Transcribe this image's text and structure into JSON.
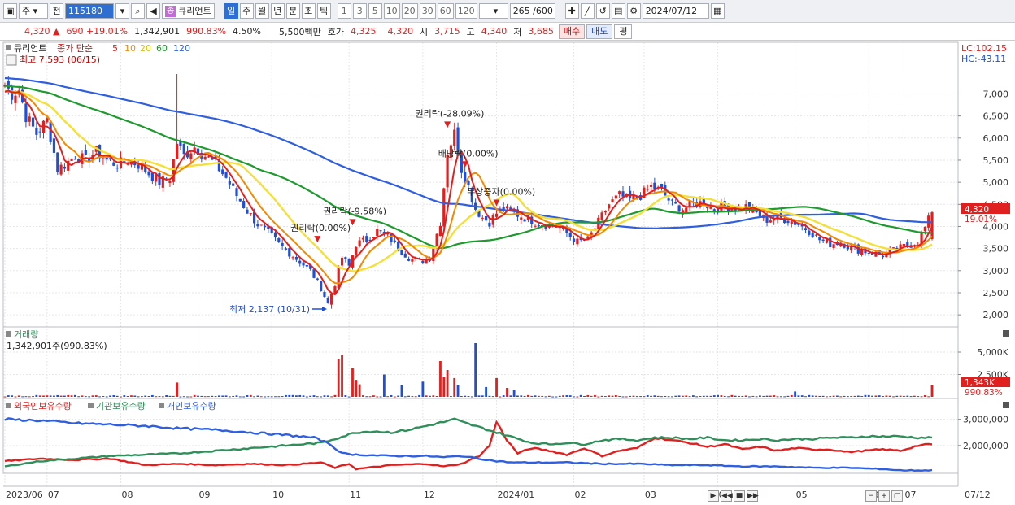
{
  "toolbar": {
    "period_type": "주",
    "prev_label": "전",
    "stock_code": "115180",
    "tag": "종",
    "stock_name": "큐리언트",
    "period_buttons": [
      "일",
      "주",
      "월",
      "년",
      "분",
      "초",
      "틱"
    ],
    "active_period": "일",
    "interval_buttons": [
      "1",
      "3",
      "5",
      "10",
      "20",
      "30",
      "60",
      "120"
    ],
    "count_display": "265 /600",
    "date": "2024/07/12"
  },
  "quote": {
    "price": "4,320 ▲",
    "change": "690 +19.01%",
    "volume": "1,342,901",
    "volume_ratio": "990.83%",
    "turnover_rate": "4.50%",
    "amount": "5,500백만",
    "hoga_label": "호가",
    "ask": "4,325",
    "bid": "4,320",
    "open_label": "시",
    "open": "3,715",
    "high_label": "고",
    "high": "4,340",
    "low_label": "저",
    "low": "3,685",
    "buy_label": "매수",
    "sell_label": "매도",
    "eval_label": "평"
  },
  "colors": {
    "up": "#e0201f",
    "down": "#1f4fd8",
    "ma5": "#e0201f",
    "ma10": "#f28a00",
    "ma20": "#f3e03a",
    "ma60": "#1e9a2e",
    "ma120": "#2f5fe0",
    "foreign": "#e0201f",
    "institution": "#2f8f5a",
    "individual": "#2f5fe0"
  },
  "chart_data": [
    {
      "type": "candlestick",
      "title": "큐리언트",
      "ma_label": "종가 단순",
      "ma_periods": [
        "5",
        "10",
        "20",
        "60",
        "120"
      ],
      "high_note": "최고 7,593 (06/15)",
      "low_note": "최저 2,137 (10/31)",
      "lc_label": "LC:102.15",
      "hc_label": "HC:-43.11",
      "last_price_label": "4,320",
      "last_change_label": "19.01%",
      "ylim": [
        1800,
        7800
      ],
      "yticks": [
        "7,000",
        "6,500",
        "6,000",
        "5,500",
        "5,000",
        "4,500",
        "4,000",
        "3,500",
        "3,000",
        "2,500",
        "2,000"
      ],
      "ytick_values": [
        7000,
        6500,
        6000,
        5500,
        5000,
        4500,
        4000,
        3500,
        3000,
        2500,
        2000
      ],
      "x_labels": [
        "2023/06",
        "07",
        "08",
        "09",
        "10",
        "11",
        "12",
        "2024/01",
        "02",
        "03",
        "04",
        "05",
        "06",
        "07",
        "07/12"
      ],
      "annotations": [
        {
          "text": "권리락(-28.09%)",
          "x": 126,
          "y": 6450
        },
        {
          "text": "배당락(0.00%)",
          "x": 131,
          "y": 5550
        },
        {
          "text": "권리락(-9.58%)",
          "x": 99,
          "y": 4240
        },
        {
          "text": "권리락(0.00%)",
          "x": 89,
          "y": 3860
        },
        {
          "text": "무상증자(0.00%)",
          "x": 140,
          "y": 4680
        }
      ],
      "price_anchors": [
        [
          0,
          7200
        ],
        [
          2,
          7000
        ],
        [
          4,
          7100
        ],
        [
          6,
          6500
        ],
        [
          9,
          6100
        ],
        [
          12,
          6400
        ],
        [
          15,
          5300
        ],
        [
          17,
          5400
        ],
        [
          20,
          5600
        ],
        [
          23,
          5500
        ],
        [
          26,
          5700
        ],
        [
          29,
          5500
        ],
        [
          32,
          5400
        ],
        [
          35,
          5500
        ],
        [
          38,
          5400
        ],
        [
          41,
          5200
        ],
        [
          44,
          5000
        ],
        [
          47,
          5100
        ],
        [
          49,
          5900
        ],
        [
          51,
          5600
        ],
        [
          54,
          5800
        ],
        [
          57,
          5600
        ],
        [
          60,
          5400
        ],
        [
          63,
          5100
        ],
        [
          66,
          4700
        ],
        [
          69,
          4350
        ],
        [
          72,
          4050
        ],
        [
          75,
          3850
        ],
        [
          78,
          3600
        ],
        [
          81,
          3400
        ],
        [
          84,
          3200
        ],
        [
          87,
          3000
        ],
        [
          90,
          2600
        ],
        [
          92,
          2250
        ],
        [
          94,
          2700
        ],
        [
          96,
          3300
        ],
        [
          98,
          3100
        ],
        [
          100,
          3600
        ],
        [
          103,
          3700
        ],
        [
          106,
          3900
        ],
        [
          109,
          3800
        ],
        [
          112,
          3500
        ],
        [
          115,
          3300
        ],
        [
          118,
          3200
        ],
        [
          121,
          3300
        ],
        [
          124,
          4100
        ],
        [
          126,
          5700
        ],
        [
          128,
          6100
        ],
        [
          130,
          5300
        ],
        [
          132,
          4900
        ],
        [
          134,
          4400
        ],
        [
          136,
          4200
        ],
        [
          138,
          4100
        ],
        [
          140,
          4300
        ],
        [
          142,
          4400
        ],
        [
          145,
          4300
        ],
        [
          148,
          4200
        ],
        [
          151,
          4100
        ],
        [
          154,
          4050
        ],
        [
          157,
          4000
        ],
        [
          160,
          3850
        ],
        [
          163,
          3650
        ],
        [
          166,
          3700
        ],
        [
          169,
          4100
        ],
        [
          172,
          4500
        ],
        [
          175,
          4700
        ],
        [
          178,
          4600
        ],
        [
          181,
          4700
        ],
        [
          184,
          4900
        ],
        [
          187,
          4800
        ],
        [
          190,
          4500
        ],
        [
          193,
          4400
        ],
        [
          196,
          4500
        ],
        [
          199,
          4550
        ],
        [
          202,
          4400
        ],
        [
          205,
          4450
        ],
        [
          208,
          4400
        ],
        [
          211,
          4450
        ],
        [
          214,
          4300
        ],
        [
          217,
          4150
        ],
        [
          220,
          4200
        ],
        [
          223,
          4150
        ],
        [
          226,
          4050
        ],
        [
          229,
          3900
        ],
        [
          232,
          3700
        ],
        [
          235,
          3600
        ],
        [
          238,
          3650
        ],
        [
          241,
          3500
        ],
        [
          244,
          3450
        ],
        [
          247,
          3400
        ],
        [
          250,
          3350
        ],
        [
          253,
          3450
        ],
        [
          256,
          3550
        ],
        [
          260,
          3630
        ],
        [
          264,
          4320
        ]
      ],
      "spike_highs": [
        [
          49,
          7450
        ],
        [
          128,
          6350
        ],
        [
          93,
          2137
        ]
      ]
    },
    {
      "type": "bar",
      "title": "거래량",
      "volume_text": "1,342,901주(990.83%)",
      "last_label": "1,343K",
      "last_change_label": "990.83%",
      "ylim": [
        0,
        6000000
      ],
      "yticks": [
        "5,000K",
        "2,500K"
      ],
      "ytick_values": [
        5000000,
        2500000
      ],
      "spikes": [
        [
          49,
          1600000
        ],
        [
          95,
          4200000
        ],
        [
          96,
          4700000
        ],
        [
          99,
          3200000
        ],
        [
          100,
          1900000
        ],
        [
          101,
          1400000
        ],
        [
          108,
          2500000
        ],
        [
          113,
          1300000
        ],
        [
          119,
          1700000
        ],
        [
          124,
          4000000
        ],
        [
          125,
          2200000
        ],
        [
          126,
          3000000
        ],
        [
          128,
          2100000
        ],
        [
          129,
          1300000
        ],
        [
          134,
          6000000
        ],
        [
          137,
          1100000
        ],
        [
          140,
          2100000
        ],
        [
          143,
          1000000
        ],
        [
          145,
          800000
        ],
        [
          225,
          600000
        ],
        [
          264,
          1343000
        ]
      ]
    },
    {
      "type": "line",
      "series_names": [
        "외국인보유수량",
        "기관보유수량",
        "개인보유수량"
      ],
      "ylim": [
        1000000,
        3300000
      ],
      "yticks": [
        "3,000,000",
        "2,000,000"
      ],
      "ytick_values": [
        3000000,
        2000000
      ],
      "series": [
        {
          "name": "외국인보유수량",
          "anchors": [
            [
              0,
              1400000
            ],
            [
              10,
              1500000
            ],
            [
              20,
              1450000
            ],
            [
              30,
              1500000
            ],
            [
              40,
              1250000
            ],
            [
              50,
              1300000
            ],
            [
              60,
              1250000
            ],
            [
              70,
              1300000
            ],
            [
              80,
              1250000
            ],
            [
              90,
              1350000
            ],
            [
              94,
              1150000
            ],
            [
              98,
              1300000
            ],
            [
              100,
              1100000
            ],
            [
              110,
              1250000
            ],
            [
              120,
              1300000
            ],
            [
              125,
              1200000
            ],
            [
              130,
              1300000
            ],
            [
              135,
              1600000
            ],
            [
              138,
              2000000
            ],
            [
              140,
              2900000
            ],
            [
              143,
              2200000
            ],
            [
              146,
              1700000
            ],
            [
              150,
              1900000
            ],
            [
              155,
              1800000
            ],
            [
              160,
              1650000
            ],
            [
              165,
              1900000
            ],
            [
              170,
              1600000
            ],
            [
              175,
              1800000
            ],
            [
              180,
              1900000
            ],
            [
              185,
              2300000
            ],
            [
              190,
              2200000
            ],
            [
              195,
              2100000
            ],
            [
              200,
              1950000
            ],
            [
              205,
              2050000
            ],
            [
              210,
              1850000
            ],
            [
              215,
              1950000
            ],
            [
              220,
              1800000
            ],
            [
              225,
              1900000
            ],
            [
              230,
              1850000
            ],
            [
              235,
              1850000
            ],
            [
              240,
              1750000
            ],
            [
              245,
              1800000
            ],
            [
              250,
              1850000
            ],
            [
              255,
              1800000
            ],
            [
              260,
              2000000
            ],
            [
              264,
              2050000
            ]
          ]
        },
        {
          "name": "기관보유수량",
          "anchors": [
            [
              0,
              1200000
            ],
            [
              10,
              1400000
            ],
            [
              20,
              1500000
            ],
            [
              30,
              1600000
            ],
            [
              40,
              1650000
            ],
            [
              50,
              1700000
            ],
            [
              60,
              1800000
            ],
            [
              70,
              1900000
            ],
            [
              80,
              2000000
            ],
            [
              90,
              2100000
            ],
            [
              95,
              2300000
            ],
            [
              100,
              2500000
            ],
            [
              105,
              2550000
            ],
            [
              110,
              2500000
            ],
            [
              115,
              2600000
            ],
            [
              120,
              2750000
            ],
            [
              125,
              2900000
            ],
            [
              128,
              3000000
            ],
            [
              130,
              2900000
            ],
            [
              135,
              2700000
            ],
            [
              140,
              2500000
            ],
            [
              145,
              2300000
            ],
            [
              150,
              2100000
            ],
            [
              155,
              2050000
            ],
            [
              160,
              2100000
            ],
            [
              165,
              2050000
            ],
            [
              170,
              2200000
            ],
            [
              175,
              2250000
            ],
            [
              180,
              2200000
            ],
            [
              185,
              2300000
            ],
            [
              190,
              2300000
            ],
            [
              195,
              2250000
            ],
            [
              200,
              2300000
            ],
            [
              205,
              2200000
            ],
            [
              210,
              2200000
            ],
            [
              215,
              2250000
            ],
            [
              220,
              2200000
            ],
            [
              225,
              2250000
            ],
            [
              230,
              2250000
            ],
            [
              235,
              2300000
            ],
            [
              240,
              2300000
            ],
            [
              245,
              2350000
            ],
            [
              250,
              2350000
            ],
            [
              255,
              2350000
            ],
            [
              260,
              2300000
            ],
            [
              264,
              2300000
            ]
          ]
        },
        {
          "name": "개인보유수량",
          "anchors": [
            [
              0,
              3000000
            ],
            [
              10,
              2950000
            ],
            [
              20,
              2850000
            ],
            [
              30,
              2800000
            ],
            [
              40,
              2750000
            ],
            [
              50,
              2650000
            ],
            [
              60,
              2600000
            ],
            [
              70,
              2500000
            ],
            [
              80,
              2400000
            ],
            [
              88,
              2300000
            ],
            [
              92,
              2100000
            ],
            [
              96,
              1700000
            ],
            [
              100,
              1650000
            ],
            [
              110,
              1600000
            ],
            [
              120,
              1600000
            ],
            [
              125,
              1550000
            ],
            [
              130,
              1600000
            ],
            [
              135,
              1500000
            ],
            [
              140,
              1400000
            ],
            [
              145,
              1350000
            ],
            [
              150,
              1350000
            ],
            [
              160,
              1350000
            ],
            [
              170,
              1300000
            ],
            [
              180,
              1300000
            ],
            [
              190,
              1250000
            ],
            [
              200,
              1250000
            ],
            [
              210,
              1200000
            ],
            [
              220,
              1200000
            ],
            [
              230,
              1150000
            ],
            [
              240,
              1150000
            ],
            [
              250,
              1100000
            ],
            [
              255,
              1050000
            ],
            [
              260,
              1050000
            ],
            [
              264,
              1050000
            ]
          ]
        }
      ]
    }
  ],
  "status": {
    "date_axis_end": "07/12"
  }
}
